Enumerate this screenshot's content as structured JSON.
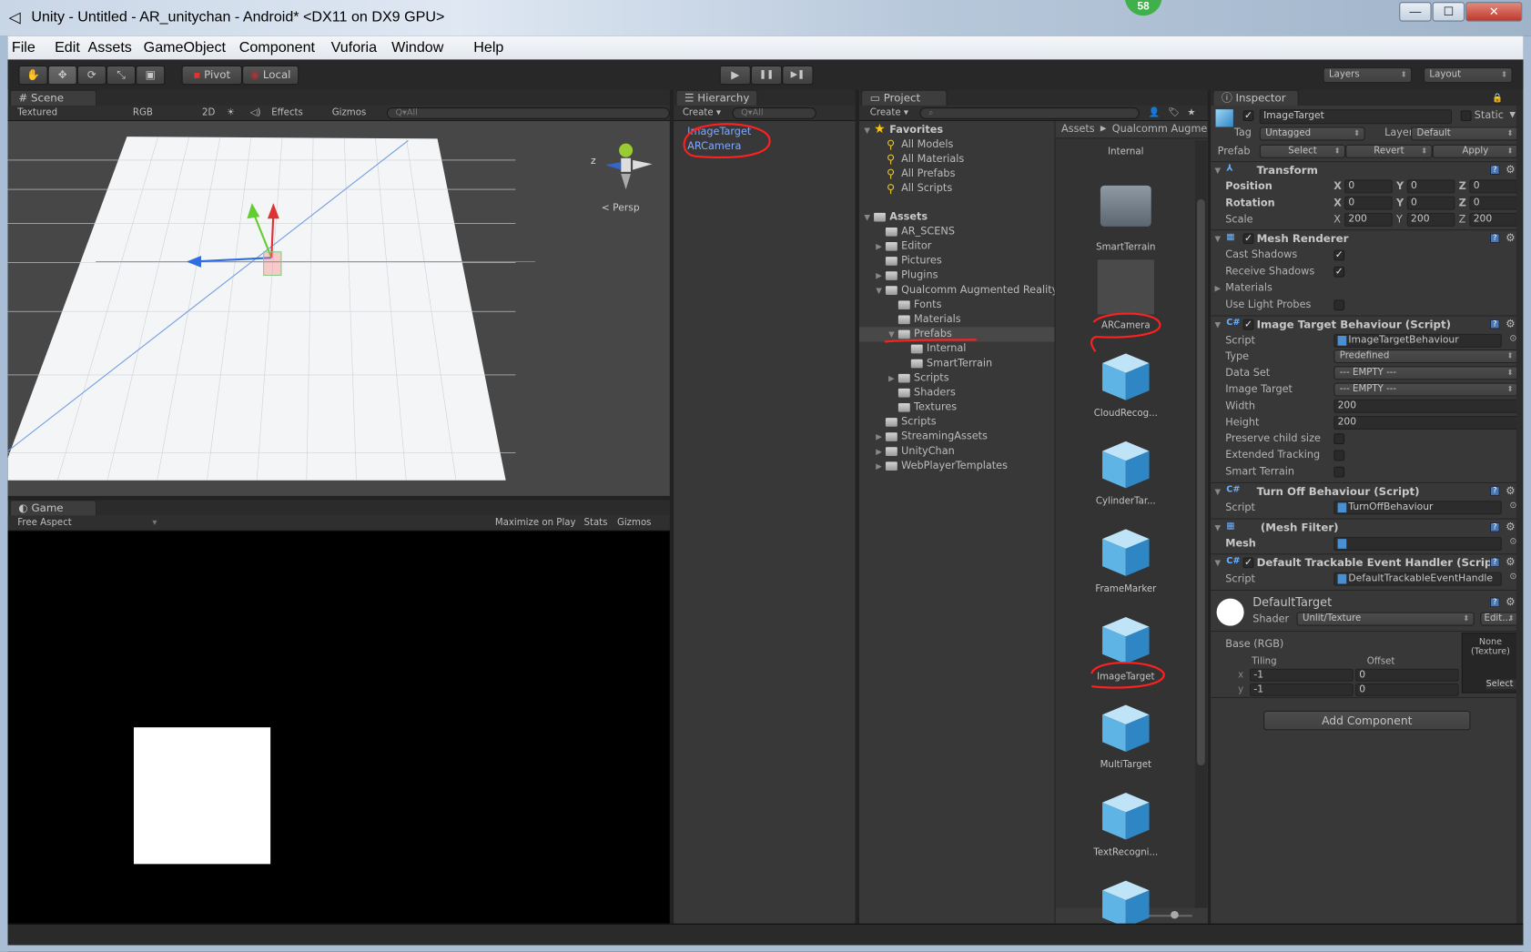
{
  "window": {
    "title": "Unity - Untitled - AR_unitychan - Android* <DX11 on DX9 GPU>",
    "badge": "58",
    "minimize": "—",
    "maximize": "☐",
    "close": "✕"
  },
  "menu": [
    "File",
    "Edit",
    "Assets",
    "GameObject",
    "Component",
    "Vuforia",
    "Window",
    "Help"
  ],
  "toolbar": {
    "tools": [
      "hand-icon",
      "move-icon",
      "rotate-icon",
      "scale-icon",
      "rect-icon"
    ],
    "pivot": "Pivot",
    "local": "Local",
    "play": "▶",
    "pause": "❚❚",
    "step": "▶❚",
    "layers": "Layers",
    "layout": "Layout"
  },
  "scene": {
    "tab": "Scene",
    "render_mode": "Textured",
    "channel": "RGB",
    "mode_2d": "2D",
    "effects": "Effects",
    "gizmos": "Gizmos",
    "search_placeholder": "Q▾All",
    "persp": "< Persp",
    "axis_z": "z"
  },
  "game": {
    "tab": "Game",
    "aspect": "Free Aspect",
    "maximize": "Maximize on Play",
    "stats": "Stats",
    "gizmos": "Gizmos"
  },
  "hierarchy": {
    "tab": "Hierarchy",
    "create": "Create ▾",
    "search_placeholder": "Q▾All",
    "items": [
      {
        "label": "ImageTarget",
        "selected": false
      },
      {
        "label": "ARCamera",
        "selected": false
      }
    ],
    "prefab_color": "#7fa8ff"
  },
  "project": {
    "tab": "Project",
    "create": "Create ▾",
    "breadcrumb": [
      "Assets",
      "Qualcomm Augme"
    ],
    "tree": [
      {
        "label": "Favorites",
        "level": 0,
        "icon": "star",
        "arrow": "down",
        "bold": true
      },
      {
        "label": "All Models",
        "level": 1,
        "icon": "search"
      },
      {
        "label": "All Materials",
        "level": 1,
        "icon": "search"
      },
      {
        "label": "All Prefabs",
        "level": 1,
        "icon": "search"
      },
      {
        "label": "All Scripts",
        "level": 1,
        "icon": "search"
      },
      {
        "label": "Assets",
        "level": 0,
        "icon": "folder",
        "arrow": "down",
        "bold": true,
        "gap": true
      },
      {
        "label": "AR_SCENS",
        "level": 1,
        "icon": "folder"
      },
      {
        "label": "Editor",
        "level": 1,
        "icon": "folder",
        "arrow": "right"
      },
      {
        "label": "Pictures",
        "level": 1,
        "icon": "folder"
      },
      {
        "label": "Plugins",
        "level": 1,
        "icon": "folder",
        "arrow": "right"
      },
      {
        "label": "Qualcomm Augmented Reality",
        "level": 1,
        "icon": "folder",
        "arrow": "down"
      },
      {
        "label": "Fonts",
        "level": 2,
        "icon": "folder"
      },
      {
        "label": "Materials",
        "level": 2,
        "icon": "folder"
      },
      {
        "label": "Prefabs",
        "level": 2,
        "icon": "folder",
        "arrow": "down",
        "selected": true
      },
      {
        "label": "Internal",
        "level": 3,
        "icon": "folder"
      },
      {
        "label": "SmartTerrain",
        "level": 3,
        "icon": "folder"
      },
      {
        "label": "Scripts",
        "level": 2,
        "icon": "folder",
        "arrow": "right"
      },
      {
        "label": "Shaders",
        "level": 2,
        "icon": "folder"
      },
      {
        "label": "Textures",
        "level": 2,
        "icon": "folder"
      },
      {
        "label": "Scripts",
        "level": 1,
        "icon": "folder"
      },
      {
        "label": "StreamingAssets",
        "level": 1,
        "icon": "folder",
        "arrow": "right"
      },
      {
        "label": "UnityChan",
        "level": 1,
        "icon": "folder",
        "arrow": "right"
      },
      {
        "label": "WebPlayerTemplates",
        "level": 1,
        "icon": "folder",
        "arrow": "right"
      }
    ],
    "grid": [
      {
        "label": "Internal",
        "icon": "none"
      },
      {
        "label": "SmartTerrain",
        "icon": "folder"
      },
      {
        "label": "ARCamera",
        "icon": "blank"
      },
      {
        "label": "CloudRecog...",
        "icon": "cube"
      },
      {
        "label": "CylinderTar...",
        "icon": "cube"
      },
      {
        "label": "FrameMarker",
        "icon": "cube"
      },
      {
        "label": "ImageTarget",
        "icon": "cube"
      },
      {
        "label": "MultiTarget",
        "icon": "cube"
      },
      {
        "label": "TextRecogni...",
        "icon": "cube"
      },
      {
        "label": "",
        "icon": "cube"
      }
    ]
  },
  "inspector": {
    "tab": "Inspector",
    "object_name": "ImageTarget",
    "static_label": "Static",
    "tag_label": "Tag",
    "tag_value": "Untagged",
    "layer_label": "Layer",
    "layer_value": "Default",
    "prefab_label": "Prefab",
    "prefab_buttons": [
      "Select",
      "Revert",
      "Apply"
    ],
    "components": [
      {
        "title": "Transform",
        "icon": "transform",
        "checkbox": false,
        "rows": [
          {
            "label": "Position",
            "bold": true,
            "xyz": [
              "0",
              "0",
              "0"
            ]
          },
          {
            "label": "Rotation",
            "bold": true,
            "xyz": [
              "0",
              "0",
              "0"
            ]
          },
          {
            "label": "Scale",
            "xyz": [
              "200",
              "200",
              "200"
            ]
          }
        ]
      },
      {
        "title": "Mesh Renderer",
        "icon": "mesh-renderer",
        "checkbox": true,
        "rows": [
          {
            "label": "Cast Shadows",
            "check": true
          },
          {
            "label": "Receive Shadows",
            "check": true
          },
          {
            "label": "Materials",
            "foldout": true
          },
          {
            "label": "Use Light Probes",
            "check": false
          }
        ]
      },
      {
        "title": "Image Target Behaviour (Script)",
        "icon": "script",
        "checkbox": true,
        "rows": [
          {
            "label": "Script",
            "object": "ImageTargetBehaviour"
          },
          {
            "label": "Type",
            "dropdown": "Predefined"
          },
          {
            "label": "Data Set",
            "dropdown": "--- EMPTY ---"
          },
          {
            "label": "Image Target",
            "dropdown": "--- EMPTY ---"
          },
          {
            "label": "Width",
            "text": "200"
          },
          {
            "label": "Height",
            "text": "200"
          },
          {
            "label": "Preserve child size",
            "check": false
          },
          {
            "label": "Extended Tracking",
            "check": false
          },
          {
            "label": "Smart Terrain",
            "check": false
          }
        ]
      },
      {
        "title": "Turn Off Behaviour (Script)",
        "icon": "script",
        "checkbox": false,
        "rows": [
          {
            "label": "Script",
            "object": "TurnOffBehaviour"
          }
        ]
      },
      {
        "title": "(Mesh Filter)",
        "icon": "mesh",
        "checkbox": false,
        "rows": [
          {
            "label": "Mesh",
            "bold": true,
            "object": ""
          }
        ]
      },
      {
        "title": "Default Trackable Event Handler (Scrip",
        "icon": "script",
        "checkbox": true,
        "rows": [
          {
            "label": "Script",
            "object": "DefaultTrackableEventHandle"
          }
        ]
      }
    ],
    "material": {
      "name": "DefaultTarget",
      "shader_label": "Shader",
      "shader": "Unlit/Texture",
      "edit": "Edit...",
      "base": "Base (RGB)",
      "tiling": "Tiling",
      "offset": "Offset",
      "x_label": "x",
      "y_label": "y",
      "tiling_x": "-1",
      "tiling_y": "-1",
      "offset_x": "0",
      "offset_y": "0",
      "texture_none": "None",
      "texture_type": "(Texture)",
      "select": "Select"
    },
    "add_component": "Add Component"
  },
  "colors": {
    "annotation": "#ff2020",
    "panel": "#383838",
    "selection": "#484848"
  }
}
